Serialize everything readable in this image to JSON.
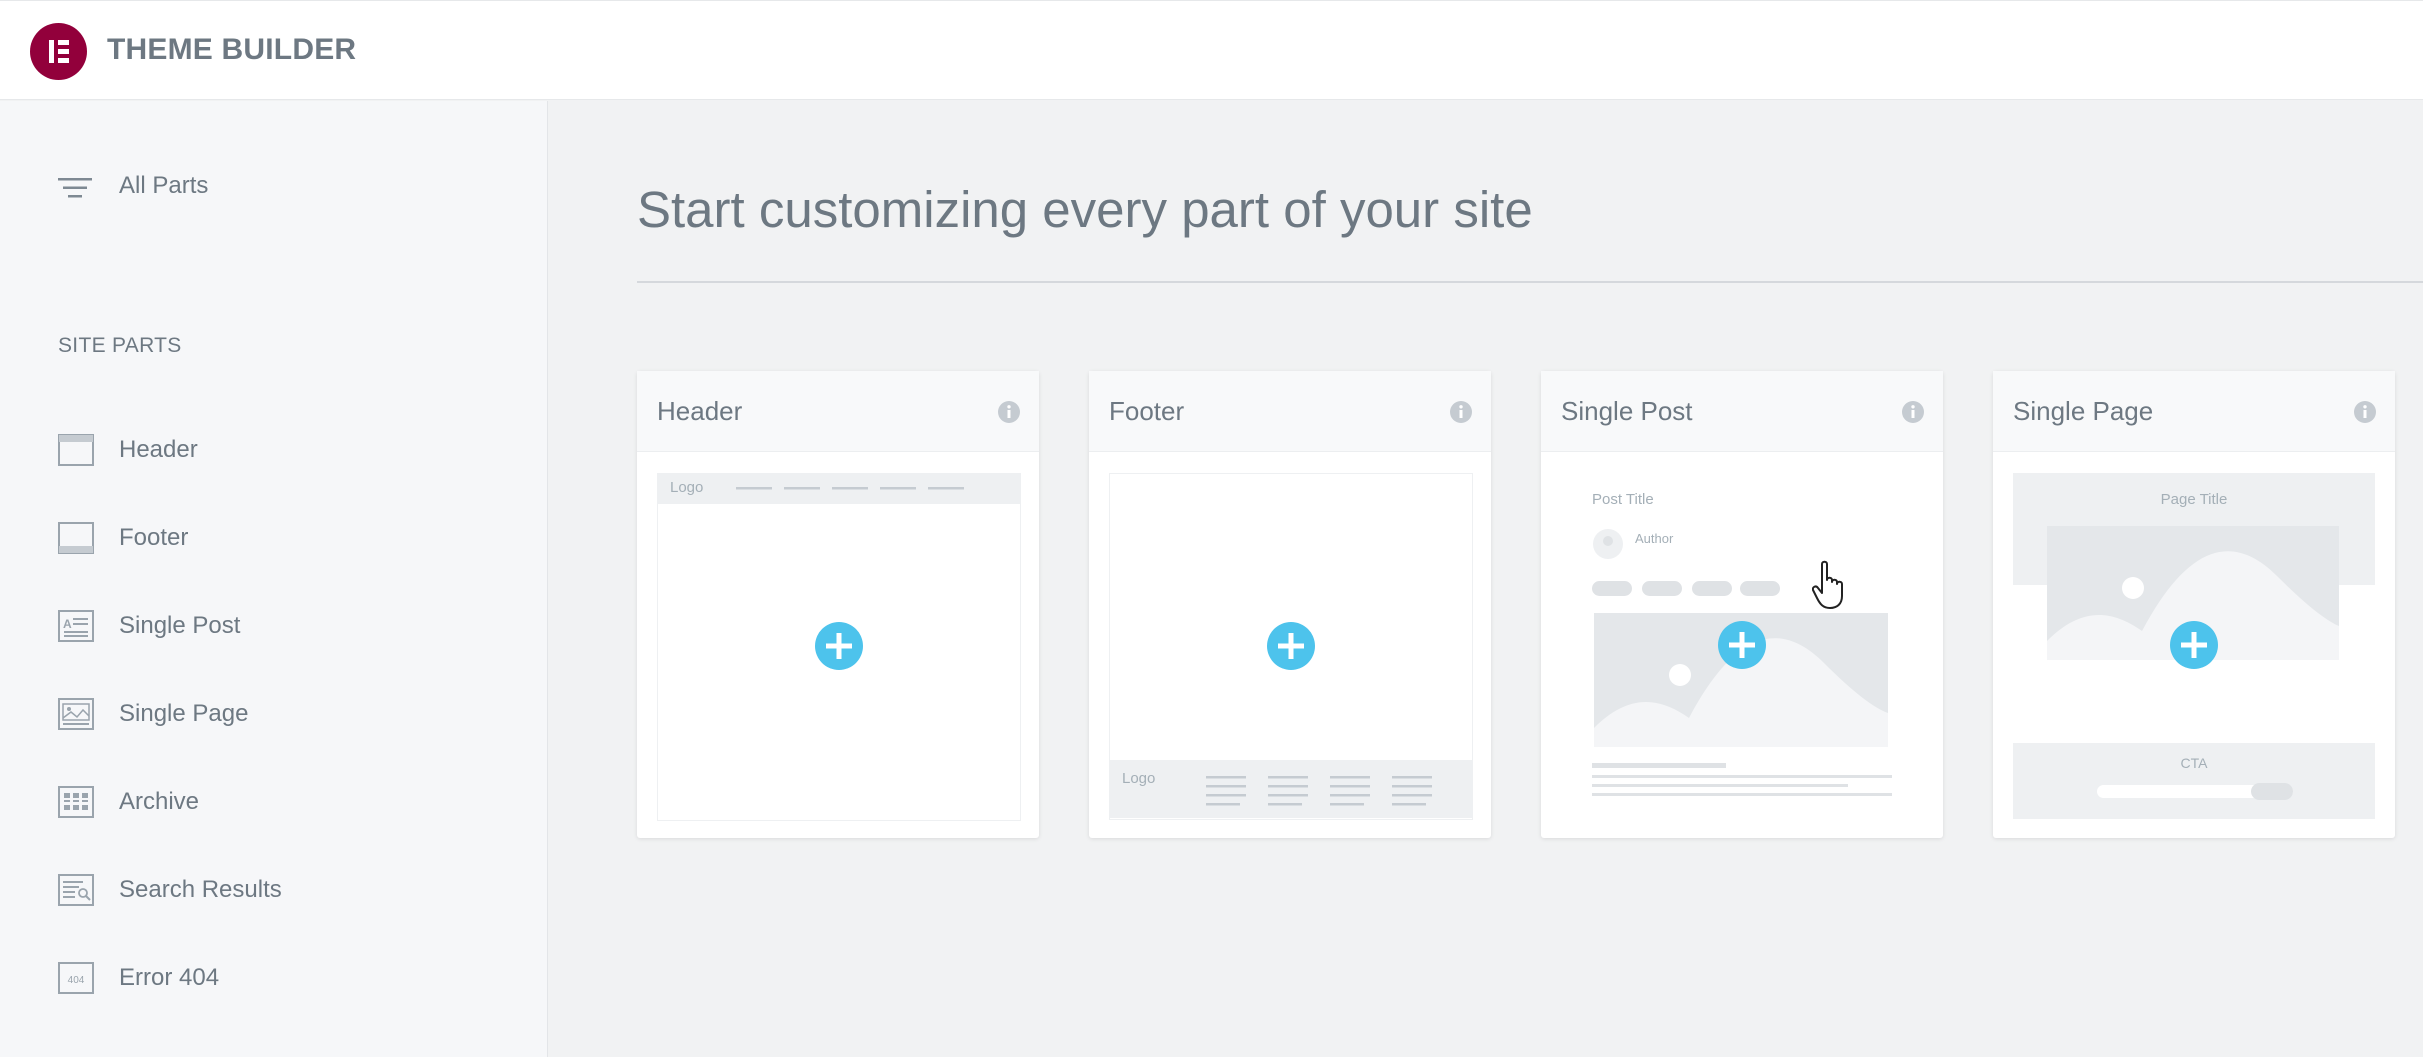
{
  "app": {
    "title": "THEME BUILDER"
  },
  "sidebar": {
    "all_parts_label": "All Parts",
    "section_title": "SITE PARTS",
    "items": [
      {
        "label": "Header",
        "icon": "header-icon"
      },
      {
        "label": "Footer",
        "icon": "footer-icon"
      },
      {
        "label": "Single Post",
        "icon": "single-post-icon"
      },
      {
        "label": "Single Page",
        "icon": "single-page-icon"
      },
      {
        "label": "Archive",
        "icon": "archive-icon"
      },
      {
        "label": "Search Results",
        "icon": "search-results-icon"
      },
      {
        "label": "Error 404",
        "icon": "error-404-icon"
      }
    ],
    "error_icon_text": "404"
  },
  "main": {
    "title": "Start customizing every part of your site",
    "cards": [
      {
        "title": "Header",
        "preview": {
          "logo": "Logo"
        }
      },
      {
        "title": "Footer",
        "preview": {
          "logo": "Logo"
        }
      },
      {
        "title": "Single Post",
        "preview": {
          "post_title": "Post Title",
          "author": "Author"
        }
      },
      {
        "title": "Single Page",
        "preview": {
          "page_title": "Page Title",
          "cta": "CTA"
        }
      }
    ]
  },
  "colors": {
    "brand": "#92003b",
    "accent": "#4dc3ec",
    "text": "#6d7882",
    "placeholder": "#e4e7ea"
  }
}
